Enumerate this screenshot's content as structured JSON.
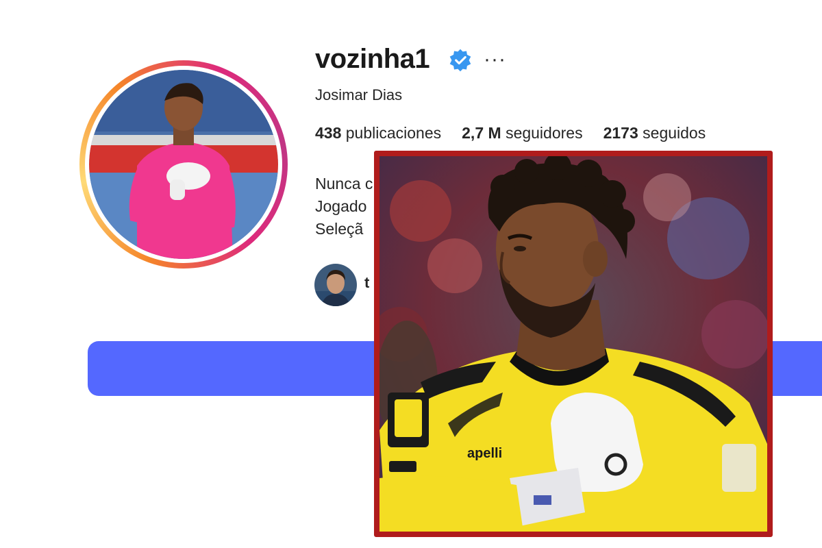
{
  "profile": {
    "username": "vozinha1",
    "verified_icon": "verified-badge-icon",
    "more_icon": "more-options-icon",
    "more_glyph": "···",
    "full_name": "Josimar Dias",
    "stats": {
      "posts_count": "438",
      "posts_label": "publicaciones",
      "followers_count": "2,7 M",
      "followers_label": "seguidores",
      "following_count": "2173",
      "following_label": "seguidos"
    },
    "bio_lines": [
      "Nunca c",
      "Jogado",
      "Seleçã"
    ],
    "mutual_text": "t"
  },
  "colors": {
    "follow_button": "#5468ff",
    "overlay_border": "#b01c1c",
    "verified": "#3897f0",
    "jersey_pink": "#f0388f",
    "jersey_yellow": "#f4dd23"
  }
}
